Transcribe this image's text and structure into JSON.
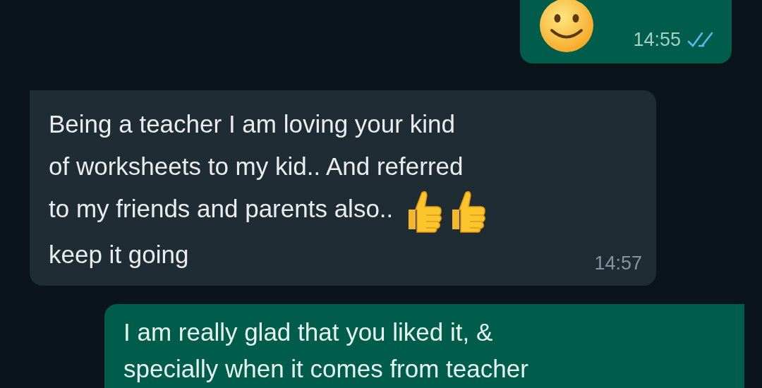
{
  "messages": [
    {
      "outgoing": true,
      "segments": [
        {
          "kind": "smiley"
        }
      ],
      "time": "14:55",
      "read": true
    },
    {
      "outgoing": false,
      "segments": [
        {
          "kind": "text",
          "text": "Being a teacher I am loving your kind"
        },
        {
          "kind": "break"
        },
        {
          "kind": "text",
          "text": "of worksheets to my kid.. And referred"
        },
        {
          "kind": "break"
        },
        {
          "kind": "text",
          "text": "to my friends and parents also.."
        },
        {
          "kind": "thumbs-up"
        },
        {
          "kind": "thumbs-up"
        },
        {
          "kind": "break"
        },
        {
          "kind": "text",
          "text": "keep it going"
        }
      ],
      "time": "14:57"
    },
    {
      "outgoing": true,
      "segments": [
        {
          "kind": "text",
          "text": "I am really glad that you liked it, &"
        },
        {
          "kind": "break"
        },
        {
          "kind": "text",
          "text": "specially when it comes from teacher"
        }
      ]
    }
  ]
}
